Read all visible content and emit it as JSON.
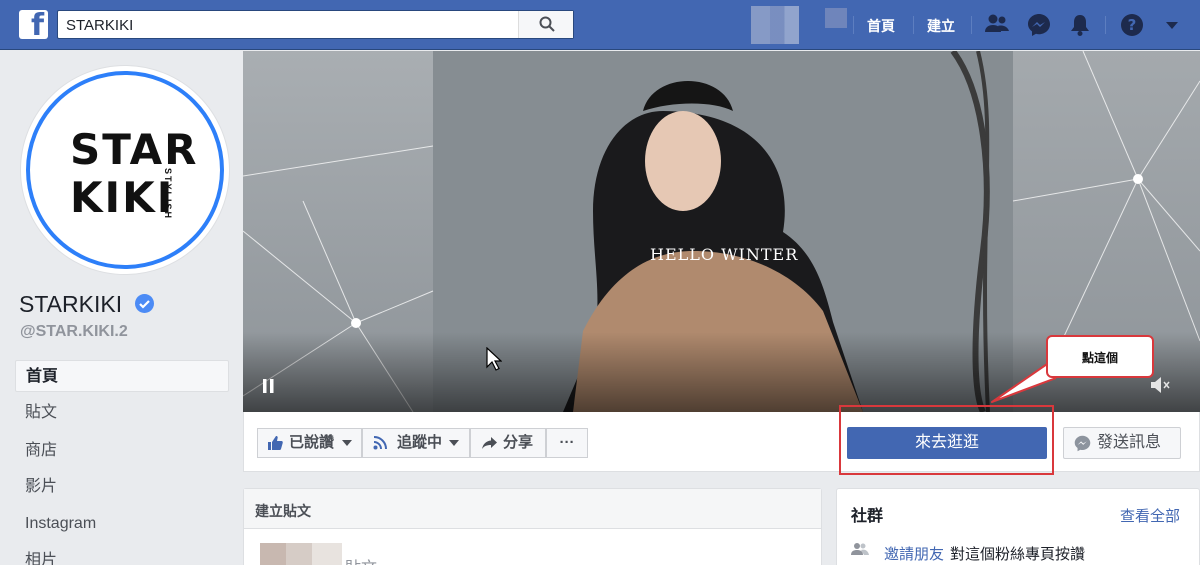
{
  "topbar": {
    "search_value": "STARKIKI",
    "nav": [
      "首頁",
      "建立"
    ],
    "icons": [
      "friends-icon",
      "messenger-icon",
      "bell-icon",
      "help-icon",
      "dropdown-icon"
    ]
  },
  "page": {
    "logo_line1": "STAR",
    "logo_line2": "KIKI",
    "logo_side": "STYLISH",
    "name": "STARKIKI",
    "handle": "@STAR.KIKI.2"
  },
  "sidebar": {
    "items": [
      {
        "label": "首頁",
        "active": true
      },
      {
        "label": "貼文"
      },
      {
        "label": "商店"
      },
      {
        "label": "影片"
      },
      {
        "label": "Instagram"
      },
      {
        "label": "相片"
      }
    ]
  },
  "cover": {
    "caption": "HELLO WINTER"
  },
  "annotation": {
    "callout": "點這個"
  },
  "actions": {
    "like": "已說讚",
    "follow": "追蹤中",
    "share": "分享",
    "more": "···",
    "shop_now": "來去逛逛",
    "send_message": "發送訊息"
  },
  "create_post": {
    "header": "建立貼文",
    "placeholder": "貼文"
  },
  "community": {
    "title": "社群",
    "see_all": "查看全部",
    "invite_link": "邀請朋友",
    "invite_text": "對這個粉絲專頁按讚"
  },
  "colors": {
    "fb_blue": "#4267b2",
    "annotation_red": "#d9383c",
    "verified_blue": "#4c8bf5"
  }
}
